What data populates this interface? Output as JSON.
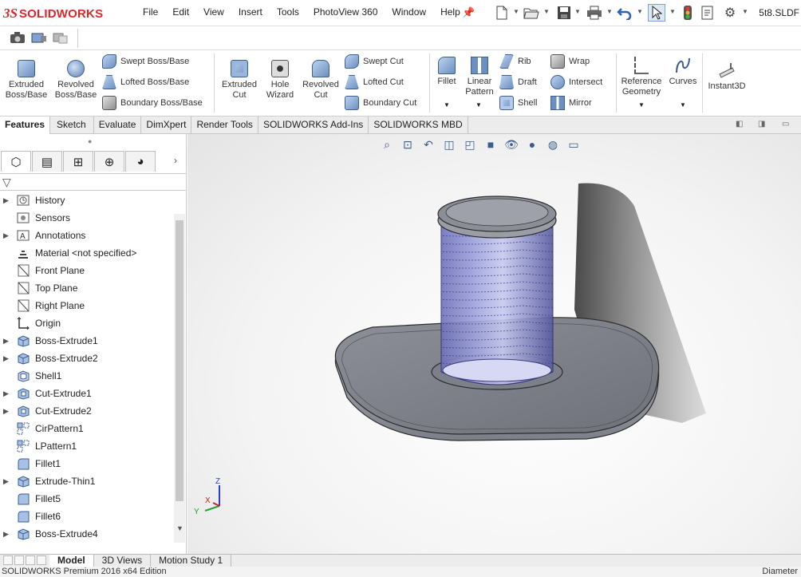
{
  "app": {
    "brand_ds": "3S",
    "brand_name": "SOLIDWORKS",
    "filename": "5t8.SLDF"
  },
  "menu": [
    "File",
    "Edit",
    "View",
    "Insert",
    "Tools",
    "PhotoView 360",
    "Window",
    "Help"
  ],
  "ribbon": {
    "extruded_boss": "Extruded Boss/Base",
    "revolved_boss": "Revolved Boss/Base",
    "swept_boss": "Swept Boss/Base",
    "lofted_boss": "Lofted Boss/Base",
    "boundary_boss": "Boundary Boss/Base",
    "extruded_cut": "Extruded Cut",
    "hole_wizard": "Hole Wizard",
    "revolved_cut": "Revolved Cut",
    "swept_cut": "Swept Cut",
    "lofted_cut": "Lofted Cut",
    "boundary_cut": "Boundary Cut",
    "fillet": "Fillet",
    "linear_pattern": "Linear Pattern",
    "rib": "Rib",
    "draft": "Draft",
    "shell": "Shell",
    "wrap": "Wrap",
    "intersect": "Intersect",
    "mirror": "Mirror",
    "reference_geometry": "Reference Geometry",
    "curves": "Curves",
    "instant3d": "Instant3D"
  },
  "command_tabs": [
    "Features",
    "Sketch",
    "Evaluate",
    "DimXpert",
    "Render Tools",
    "SOLIDWORKS Add-Ins",
    "SOLIDWORKS MBD"
  ],
  "tree": [
    {
      "label": "History",
      "icon": "history-icon",
      "expandable": true
    },
    {
      "label": "Sensors",
      "icon": "sensors-icon",
      "expandable": false
    },
    {
      "label": "Annotations",
      "icon": "annotations-icon",
      "expandable": true
    },
    {
      "label": "Material <not specified>",
      "icon": "material-icon",
      "expandable": false
    },
    {
      "label": "Front Plane",
      "icon": "plane-icon",
      "expandable": false
    },
    {
      "label": "Top Plane",
      "icon": "plane-icon",
      "expandable": false
    },
    {
      "label": "Right Plane",
      "icon": "plane-icon",
      "expandable": false
    },
    {
      "label": "Origin",
      "icon": "origin-icon",
      "expandable": false
    },
    {
      "label": "Boss-Extrude1",
      "icon": "extrude-icon",
      "expandable": true
    },
    {
      "label": "Boss-Extrude2",
      "icon": "extrude-icon",
      "expandable": true
    },
    {
      "label": "Shell1",
      "icon": "shell-icon",
      "expandable": false
    },
    {
      "label": "Cut-Extrude1",
      "icon": "cut-icon",
      "expandable": true
    },
    {
      "label": "Cut-Extrude2",
      "icon": "cut-icon",
      "expandable": true
    },
    {
      "label": "CirPattern1",
      "icon": "pattern-icon",
      "expandable": false
    },
    {
      "label": "LPattern1",
      "icon": "pattern-icon",
      "expandable": false
    },
    {
      "label": "Fillet1",
      "icon": "fillet-icon",
      "expandable": false
    },
    {
      "label": "Extrude-Thin1",
      "icon": "extrude-icon",
      "expandable": true
    },
    {
      "label": "Fillet5",
      "icon": "fillet-icon",
      "expandable": false
    },
    {
      "label": "Fillet6",
      "icon": "fillet-icon",
      "expandable": false
    },
    {
      "label": "Boss-Extrude4",
      "icon": "extrude-icon",
      "expandable": true
    }
  ],
  "axes": {
    "x": "X",
    "y": "Y",
    "z": "Z"
  },
  "bottom_tabs": [
    "Model",
    "3D Views",
    "Motion Study 1"
  ],
  "status": {
    "left": "SOLIDWORKS Premium 2016 x64 Edition",
    "right": "Diameter"
  },
  "colors": {
    "brand": "#d9262e",
    "accent": "#3b6ec9",
    "part_body": "#9a9da6",
    "thread": "#6b6fc4"
  }
}
